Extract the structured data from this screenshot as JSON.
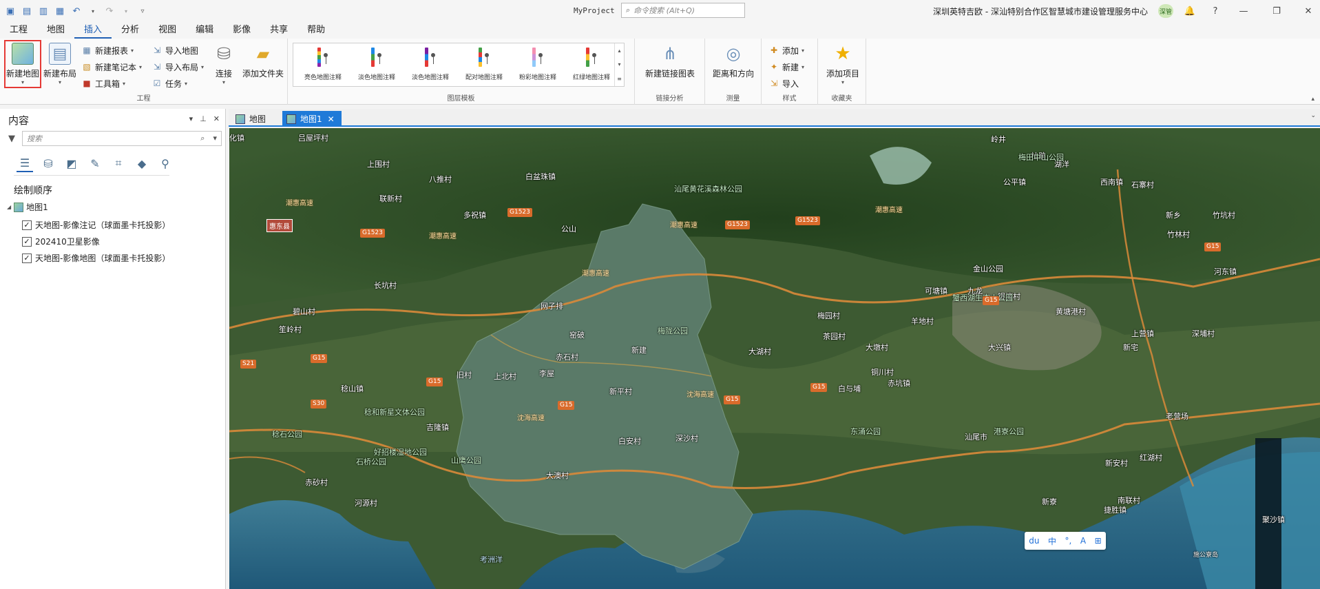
{
  "titlebar": {
    "app_title": "MyProject",
    "search_placeholder": "命令搜索 (Alt+Q)",
    "user_info": "深圳英特吉欧 - 深汕特别合作区智慧城市建设管理服务中心",
    "avatar_text": "深管",
    "help": "?"
  },
  "menu": [
    "工程",
    "地图",
    "插入",
    "分析",
    "视图",
    "编辑",
    "影像",
    "共享",
    "帮助"
  ],
  "ribbon": {
    "project_group": {
      "label": "工程",
      "new_map": "新建地图",
      "new_layout": "新建布局",
      "new_report": "新建报表",
      "new_notebook": "新建笔记本",
      "toolbox": "工具箱",
      "import_map": "导入地图",
      "import_layout": "导入布局",
      "task": "任务",
      "connect": "连接",
      "add_folder": "添加文件夹"
    },
    "layer_templates": {
      "label": "图层模板",
      "items": [
        {
          "label": "亮色地图注释",
          "colors": [
            "#e53935",
            "#fbc02d",
            "#43a047",
            "#1e88e5",
            "#8e24aa"
          ]
        },
        {
          "label": "淡色地图注释",
          "colors": [
            "#1e88e5",
            "#43a047",
            "#e53935"
          ]
        },
        {
          "label": "淡色地图注释",
          "colors": [
            "#7b1fa2",
            "#1e88e5",
            "#e53935"
          ]
        },
        {
          "label": "配对地图注释",
          "colors": [
            "#43a047",
            "#e53935",
            "#1e88e5",
            "#fbc02d"
          ]
        },
        {
          "label": "粉彩地图注释",
          "colors": [
            "#f48fb1",
            "#ce93d8",
            "#90caf9"
          ]
        },
        {
          "label": "红绿地图注释",
          "colors": [
            "#e53935",
            "#fbc02d",
            "#43a047"
          ]
        }
      ]
    },
    "link_analysis": {
      "label": "链接分析",
      "btn": "新建链接图表"
    },
    "measure": {
      "label": "测量",
      "btn": "距离和方向"
    },
    "styles": {
      "label": "样式",
      "add": "添加",
      "new": "新建",
      "import": "导入"
    },
    "favorites": {
      "label": "收藏夹",
      "btn": "添加项目"
    }
  },
  "contents": {
    "title": "内容",
    "search_placeholder": "搜索",
    "draw_order": "绘制顺序",
    "map_name": "地图1",
    "layers": [
      {
        "name": "天地图-影像注记（球面墨卡托投影）",
        "checked": true
      },
      {
        "name": "202410卫星影像",
        "checked": true
      },
      {
        "name": "天地图-影像地图（球面墨卡托投影）",
        "checked": true
      }
    ]
  },
  "tabs": [
    {
      "label": "地图",
      "active": false
    },
    {
      "label": "地图1",
      "active": true
    }
  ],
  "map": {
    "places": [
      "化镇",
      "吕屋坪村",
      "上围村",
      "八推村",
      "白盆珠镇",
      "联新村",
      "多祝镇",
      "公山",
      "惠东县",
      "长坑村",
      "碧山村",
      "笙岭村",
      "网子排",
      "窑破",
      "李屋",
      "赤石村",
      "稔山镇",
      "旧村",
      "上北村",
      "吉隆镇",
      "新建",
      "新平村",
      "白安村",
      "深沙村",
      "大湖村",
      "大墩村",
      "茶园村",
      "铜川村",
      "梅园村",
      "白与埔",
      "赤坑镇",
      "羊地村",
      "赤砂村",
      "河源村",
      "大澳村",
      "可塘镇",
      "九龙",
      "银液村",
      "黄塘港村",
      "新宅",
      "上营镇",
      "深埔村",
      "老营场",
      "红湖村",
      "新安村",
      "新寮",
      "南联村",
      "捷胜镇",
      "岭井",
      "杜鹃",
      "湖洋",
      "公平镇",
      "西南镇",
      "石寨村",
      "新乡",
      "竹林村",
      "河东镇",
      "竹坑村",
      "大兴镇",
      "汕尾市",
      "金山公园",
      "聚沙镇"
    ],
    "parks": [
      "汕尾黄花溪森林公园",
      "梅陇公园",
      "东涌公园",
      "稔石公园",
      "石桥公园",
      "好招楼湿地公园",
      "山鹰公园",
      "港寮公园",
      "蟹西湖生态小公园",
      "梅田中山公园",
      "稔和新星文体公园"
    ],
    "highways": [
      "G1523",
      "G1523",
      "G1523",
      "G1523",
      "G15",
      "G15",
      "G15",
      "G15",
      "G15",
      "G15",
      "S21",
      "S30",
      "G15"
    ],
    "highway_names": [
      "潮惠高速",
      "潮惠高速",
      "潮惠高速",
      "潮惠高速",
      "潮惠高速",
      "沈海高速",
      "沈海高速"
    ],
    "sea_label": "考洲洋",
    "island_label": "施公寮岛"
  }
}
